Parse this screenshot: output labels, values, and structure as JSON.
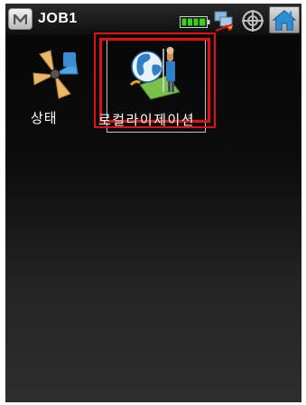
{
  "header": {
    "menu_button_icon": "m-menu-icon",
    "title": "JOB1",
    "status_icons": [
      "battery-icon",
      "network-icon",
      "satellite-icon",
      "home-icon"
    ],
    "battery_level": 1.0
  },
  "apps": [
    {
      "label": "상태",
      "icon": "status-fan-icon",
      "selected": false
    },
    {
      "label": "로컬라이제이션",
      "icon": "localization-globe-icon",
      "selected": true
    }
  ],
  "colors": {
    "selection": "#e01010",
    "background": "#0c0c0c",
    "battery": "#39d318"
  }
}
